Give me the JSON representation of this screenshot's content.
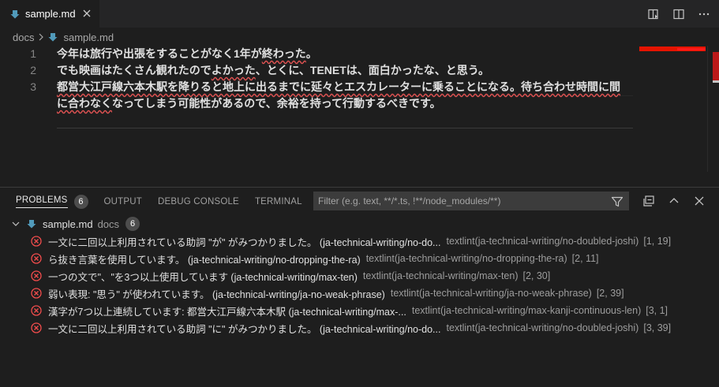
{
  "tab": {
    "title": "sample.md"
  },
  "breadcrumb": {
    "folder": "docs",
    "file": "sample.md"
  },
  "editor": {
    "line_numbers": [
      "1",
      "2",
      "3",
      ""
    ],
    "lines": [
      {
        "segments": [
          {
            "t": "今年は旅行や出張をすることがなく1年が"
          },
          {
            "t": "終わった",
            "e": true
          },
          {
            "t": "。"
          }
        ]
      },
      {
        "segments": [
          {
            "t": "でも映画はたくさん観れたので"
          },
          {
            "t": "よかった",
            "e": true
          },
          {
            "t": "、とくに、TENETは、面白かったな、と思う。"
          }
        ]
      },
      {
        "segments": [
          {
            "t": "都営大江戸線六本木駅を降りると地上に出るまでに延々とエスカレーターに乗ることになる。待ち合わせ時間に間",
            "e": true
          }
        ]
      },
      {
        "segments": [
          {
            "t": "に合わなく",
            "e": true
          },
          {
            "t": "なってしまう可能性があるので、余裕を持って行動するべきです。"
          }
        ]
      }
    ]
  },
  "panel": {
    "tabs": [
      {
        "label": "PROBLEMS",
        "badge": "6",
        "active": true
      },
      {
        "label": "OUTPUT"
      },
      {
        "label": "DEBUG CONSOLE"
      },
      {
        "label": "TERMINAL"
      }
    ],
    "filter_placeholder": "Filter (e.g. text, **/*.ts, !**/node_modules/**)",
    "group": {
      "file": "sample.md",
      "path": "docs",
      "count": "6"
    },
    "problems": [
      {
        "message": "一文に二回以上利用されている助詞 \"が\" がみつかりました。 (ja-technical-writing/no-do...",
        "source": "textlint(ja-technical-writing/no-doubled-joshi)",
        "position": "[1, 19]"
      },
      {
        "message": "ら抜き言葉を使用しています。 (ja-technical-writing/no-dropping-the-ra)",
        "source": "textlint(ja-technical-writing/no-dropping-the-ra)",
        "position": "[2, 11]"
      },
      {
        "message": "一つの文で\"、\"を3つ以上使用しています (ja-technical-writing/max-ten)",
        "source": "textlint(ja-technical-writing/max-ten)",
        "position": "[2, 30]"
      },
      {
        "message": "弱い表現: \"思う\" が使われています。 (ja-technical-writing/ja-no-weak-phrase)",
        "source": "textlint(ja-technical-writing/ja-no-weak-phrase)",
        "position": "[2, 39]"
      },
      {
        "message": "漢字が7つ以上連続しています: 都営大江戸線六本木駅 (ja-technical-writing/max-...",
        "source": "textlint(ja-technical-writing/max-kanji-continuous-len)",
        "position": "[3, 1]"
      },
      {
        "message": "一文に二回以上利用されている助詞 \"に\" がみつかりました。 (ja-technical-writing/no-do...",
        "source": "textlint(ja-technical-writing/no-doubled-joshi)",
        "position": "[3, 39]"
      }
    ]
  },
  "colors": {
    "error": "#f14c4c",
    "markdown_icon": "#519aba",
    "squiggle": "#e05252"
  }
}
